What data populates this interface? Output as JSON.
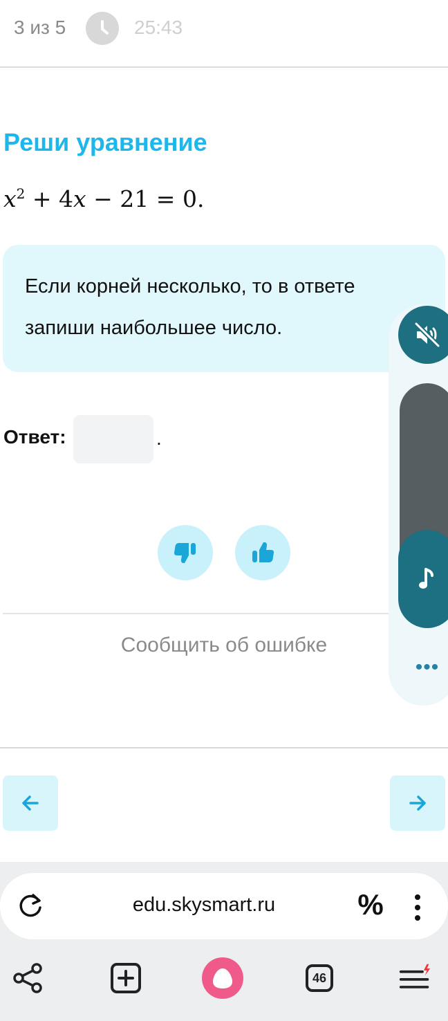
{
  "header": {
    "progress": "3 из 5",
    "timer": "25:43"
  },
  "task": {
    "title": "Реши уравнение",
    "equation": {
      "x": "x",
      "exp": "2",
      "op1": "+",
      "term2": "4",
      "x2": "x",
      "op2": "−",
      "const": "21",
      "eq": "=",
      "rhs": "0."
    },
    "hint": "Если корней несколько, то в ответе запиши наибольшее число.",
    "answer_label": "Ответ:",
    "answer_value": "",
    "answer_suffix": "."
  },
  "feedback": {
    "report_label": "Сообщить об ошибке"
  },
  "audio_widget": {
    "more_label": "•••"
  },
  "browser": {
    "url": "edu.skysmart.ru",
    "percent_label": "%",
    "tabs_count": "46"
  },
  "colors": {
    "accent": "#1db7eb",
    "hint_bg": "#e0f7fc",
    "vote_bg": "#c9f1fb",
    "vote_icon": "#1aa6d9",
    "audio_teal": "#1e6f80",
    "track_gray": "#575e61",
    "alice_pink": "#f05a8a"
  },
  "icons": {
    "clock": "clock-icon",
    "dislike": "thumbs-down-icon",
    "like": "thumbs-up-icon",
    "prev": "arrow-left-icon",
    "next": "arrow-right-icon",
    "mute": "speaker-muted-icon",
    "music": "music-note-icon",
    "reload": "reload-icon",
    "share": "share-icon",
    "new_tab": "plus-square-icon",
    "alice": "alice-assistant-icon",
    "menu": "hamburger-menu-icon"
  }
}
